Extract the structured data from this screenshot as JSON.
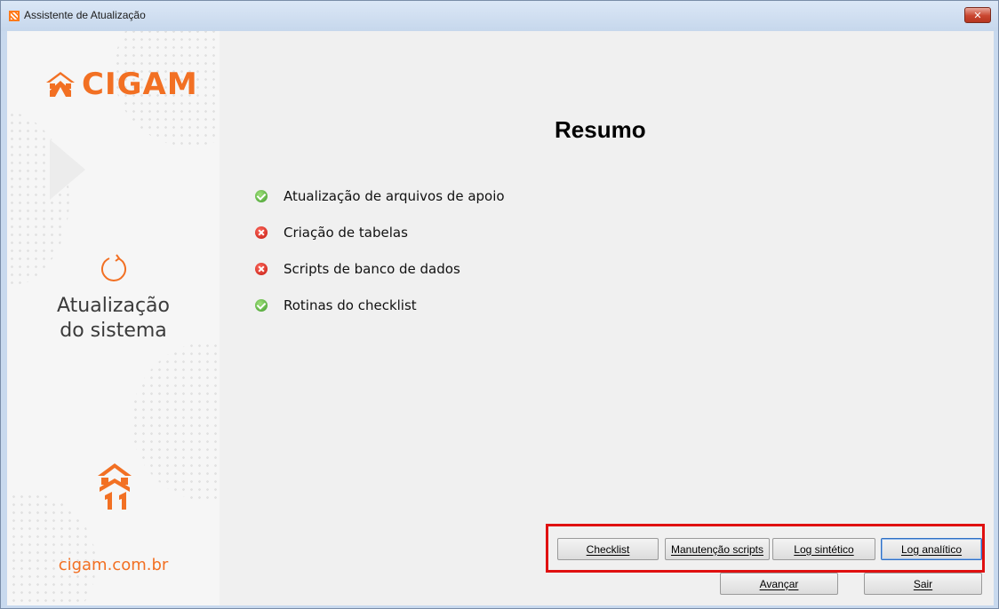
{
  "window": {
    "title": "Assistente de Atualização",
    "close_glyph": "✕"
  },
  "sidebar": {
    "brand": "CIGAM",
    "subtitle_line1": "Atualização",
    "subtitle_line2": "do sistema",
    "website": "cigam.com.br",
    "icons": [
      "cigam-logo-icon",
      "refresh-icon",
      "cigam-11-icon"
    ],
    "accent_color": "#f27023"
  },
  "main": {
    "title": "Resumo",
    "steps": [
      {
        "label": "Atualização de arquivos de apoio",
        "status": "ok"
      },
      {
        "label": "Criação de tabelas",
        "status": "error"
      },
      {
        "label": "Scripts de banco de dados",
        "status": "error"
      },
      {
        "label": "Rotinas do checklist",
        "status": "ok"
      }
    ],
    "status_colors": {
      "ok": "#3f9a2a",
      "error": "#c2190f"
    }
  },
  "buttons": {
    "checklist": "Checklist",
    "manutencao": "Manutenção scripts",
    "log_sintetico": "Log sintético",
    "log_analitico": "Log analítico",
    "avancar": "Avançar",
    "sair": "Sair"
  },
  "highlight_color": "#e01010"
}
